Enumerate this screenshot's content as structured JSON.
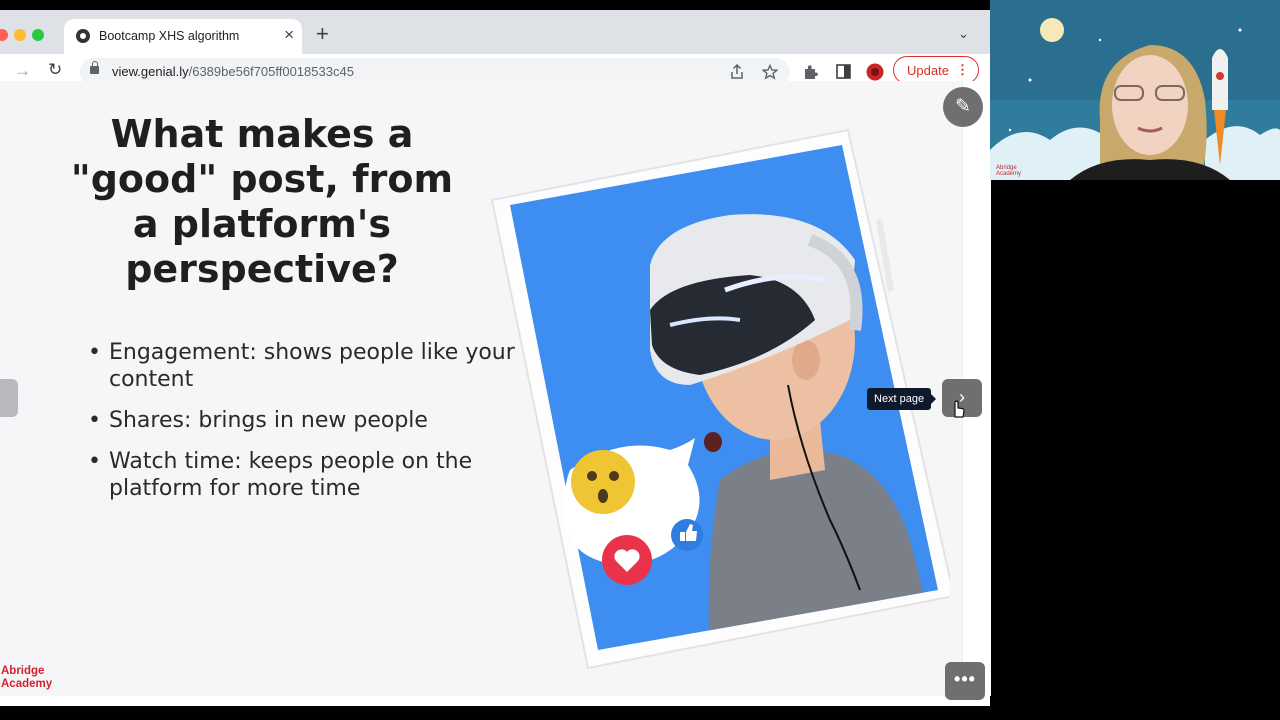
{
  "browser": {
    "tab_title": "Bootcamp XHS algorithm",
    "tab_close": "×",
    "new_tab": "+",
    "tab_menu": "⌄",
    "nav_forward": "→",
    "nav_reload": "↻",
    "url_domain": "view.genial.ly",
    "url_path": "/6389be56f705ff0018533c45",
    "update_label": "Update",
    "update_menu": "⋮",
    "colors": {
      "update_accent": "#d93025",
      "tabbar": "#dee1e6"
    }
  },
  "slide": {
    "title": "What makes a\n\"good\" post, from\na platform's\nperspective?",
    "bullets": [
      "Engagement: shows people like your content",
      "Shares: brings in new people",
      "Watch time: keeps people on the platform for more time"
    ],
    "next_tooltip": "Next page",
    "next_arrow": "›",
    "edit_icon": "✎",
    "more_icon": "•••",
    "brand": "Abridge\nAcademy",
    "colors": {
      "background": "#f6f5f8",
      "tablet_screen": "#3d8ef0",
      "brand": "#d1242f"
    }
  },
  "webcam": {
    "brand": "Abridge\nAcademy"
  }
}
